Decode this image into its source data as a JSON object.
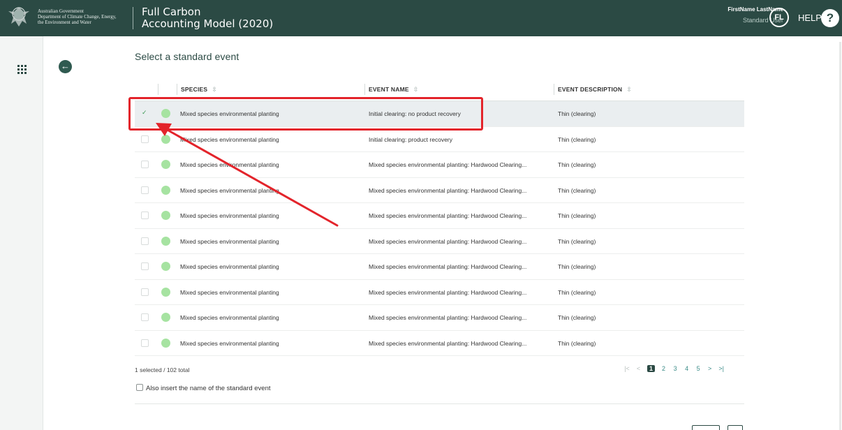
{
  "header": {
    "gov_lines": [
      "Australian Government",
      "Department of Climate Change, Energy,",
      "the Environment and Water"
    ],
    "title_line1": "Full Carbon",
    "title_line2": "Accounting Model (2020)",
    "user_name": "FirstName LastName",
    "user_role": "Standard User",
    "avatar_initials": "FL",
    "help_label": "HELP",
    "help_icon_glyph": "?"
  },
  "sidebar": {
    "icon": "apps-grid-icon"
  },
  "page": {
    "title": "Select a standard event",
    "back_icon_glyph": "←"
  },
  "table": {
    "columns": [
      {
        "label": "SPECIES",
        "sort_glyph": "⇳"
      },
      {
        "label": "EVENT NAME",
        "sort_glyph": "⇳"
      },
      {
        "label": "EVENT DESCRIPTION",
        "sort_glyph": "⇳"
      }
    ],
    "rows": [
      {
        "selected": true,
        "species": "Mixed species environmental planting",
        "event_name": "Initial clearing: no product recovery",
        "event_description": "Thin (clearing)"
      },
      {
        "selected": false,
        "species": "Mixed species environmental planting",
        "event_name": "Initial clearing: product recovery",
        "event_description": "Thin (clearing)"
      },
      {
        "selected": false,
        "species": "Mixed species environmental planting",
        "event_name": "Mixed species environmental planting: Hardwood Clearing...",
        "event_description": "Thin (clearing)"
      },
      {
        "selected": false,
        "species": "Mixed species environmental planting",
        "event_name": "Mixed species environmental planting: Hardwood Clearing...",
        "event_description": "Thin (clearing)"
      },
      {
        "selected": false,
        "species": "Mixed species environmental planting",
        "event_name": "Mixed species environmental planting: Hardwood Clearing...",
        "event_description": "Thin (clearing)"
      },
      {
        "selected": false,
        "species": "Mixed species environmental planting",
        "event_name": "Mixed species environmental planting: Hardwood Clearing...",
        "event_description": "Thin (clearing)"
      },
      {
        "selected": false,
        "species": "Mixed species environmental planting",
        "event_name": "Mixed species environmental planting: Hardwood Clearing...",
        "event_description": "Thin (clearing)"
      },
      {
        "selected": false,
        "species": "Mixed species environmental planting",
        "event_name": "Mixed species environmental planting: Hardwood Clearing...",
        "event_description": "Thin (clearing)"
      },
      {
        "selected": false,
        "species": "Mixed species environmental planting",
        "event_name": "Mixed species environmental planting: Hardwood Clearing...",
        "event_description": "Thin (clearing)"
      },
      {
        "selected": false,
        "species": "Mixed species environmental planting",
        "event_name": "Mixed species environmental planting: Hardwood Clearing...",
        "event_description": "Thin (clearing)"
      }
    ]
  },
  "footer": {
    "selection_summary": "1 selected / 102 total",
    "also_insert_label": "Also insert the name of the standard event"
  },
  "pagination": {
    "first_glyph": "|<",
    "prev_glyph": "<",
    "pages": [
      "1",
      "2",
      "3",
      "4",
      "5"
    ],
    "current_page": "1",
    "next_glyph": ">",
    "last_glyph": ">|"
  },
  "colors": {
    "header_bg": "#2b4a44",
    "status_dot": "#a6e3a1",
    "annotation_red": "#e3242b",
    "selected_row_bg": "#eaeef0"
  }
}
